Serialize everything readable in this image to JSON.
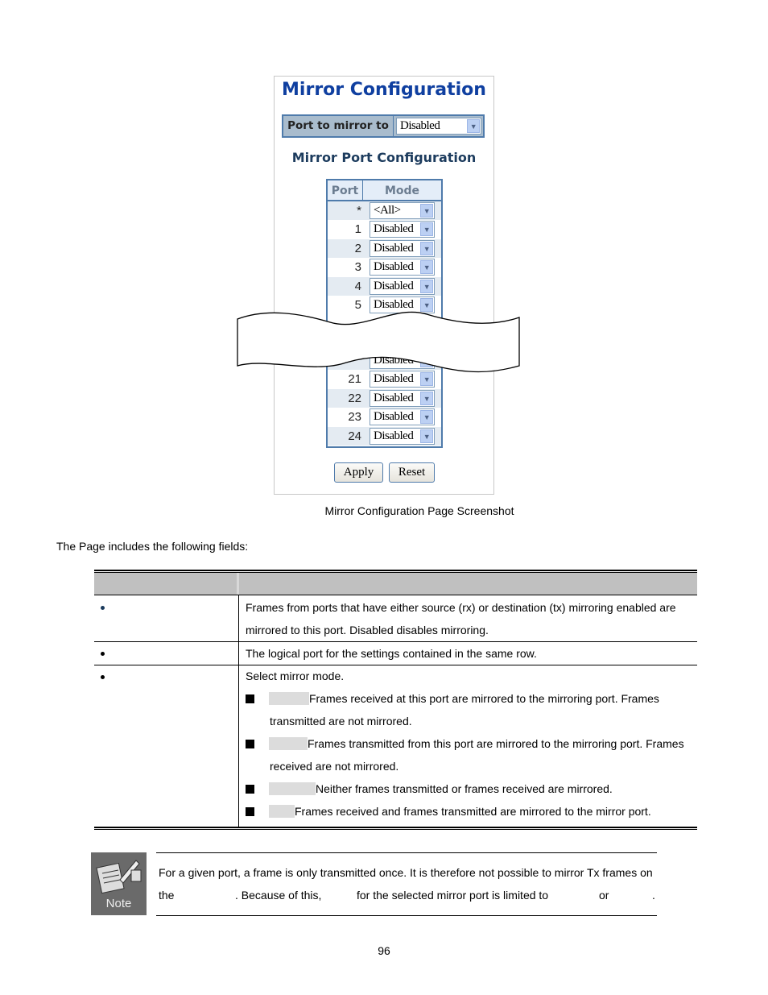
{
  "screenshot": {
    "title": "Mirror Configuration",
    "port_to_mirror_to_label": "Port to mirror to",
    "port_to_mirror_to_value": "Disabled",
    "subtitle": "Mirror Port Configuration",
    "table_headers": {
      "port": "Port",
      "mode": "Mode"
    },
    "rows_top": [
      {
        "port": "*",
        "mode": "<All>"
      },
      {
        "port": "1",
        "mode": "Disabled"
      },
      {
        "port": "2",
        "mode": "Disabled"
      },
      {
        "port": "3",
        "mode": "Disabled"
      },
      {
        "port": "4",
        "mode": "Disabled"
      },
      {
        "port": "5",
        "mode": "Disabled"
      }
    ],
    "rows_bottom": [
      {
        "port": "",
        "mode": "Disabled"
      },
      {
        "port": "21",
        "mode": "Disabled"
      },
      {
        "port": "22",
        "mode": "Disabled"
      },
      {
        "port": "23",
        "mode": "Disabled"
      },
      {
        "port": "24",
        "mode": "Disabled"
      }
    ],
    "apply_label": "Apply",
    "reset_label": "Reset",
    "caption": "Mirror Configuration Page Screenshot"
  },
  "intro": "The Page includes the following fields:",
  "fields": {
    "row1": [
      "Frames from ports that have either source (rx) or destination (tx) mirroring enabled are",
      "mirrored to this port. Disabled disables mirroring."
    ],
    "row2": "The logical port for the settings contained in the same row.",
    "row3_intro": "Select mirror mode.",
    "modes": [
      [
        "Frames received at this port are mirrored to the mirroring port. Frames",
        "transmitted are not mirrored."
      ],
      [
        "Frames transmitted from this port are mirrored to the mirroring port. Frames",
        "received are not mirrored."
      ],
      [
        "Neither frames transmitted or frames received are mirrored."
      ],
      [
        "Frames received and frames transmitted are mirrored to the mirror port."
      ]
    ]
  },
  "note": {
    "icon_label": "Note",
    "line1": "For a given port, a frame is only transmitted once. It is therefore not possible to mirror Tx frames on",
    "line2_parts": [
      "the",
      ". Because of this,",
      "for the selected mirror port is limited to",
      "or",
      "."
    ]
  },
  "page_number": "96"
}
